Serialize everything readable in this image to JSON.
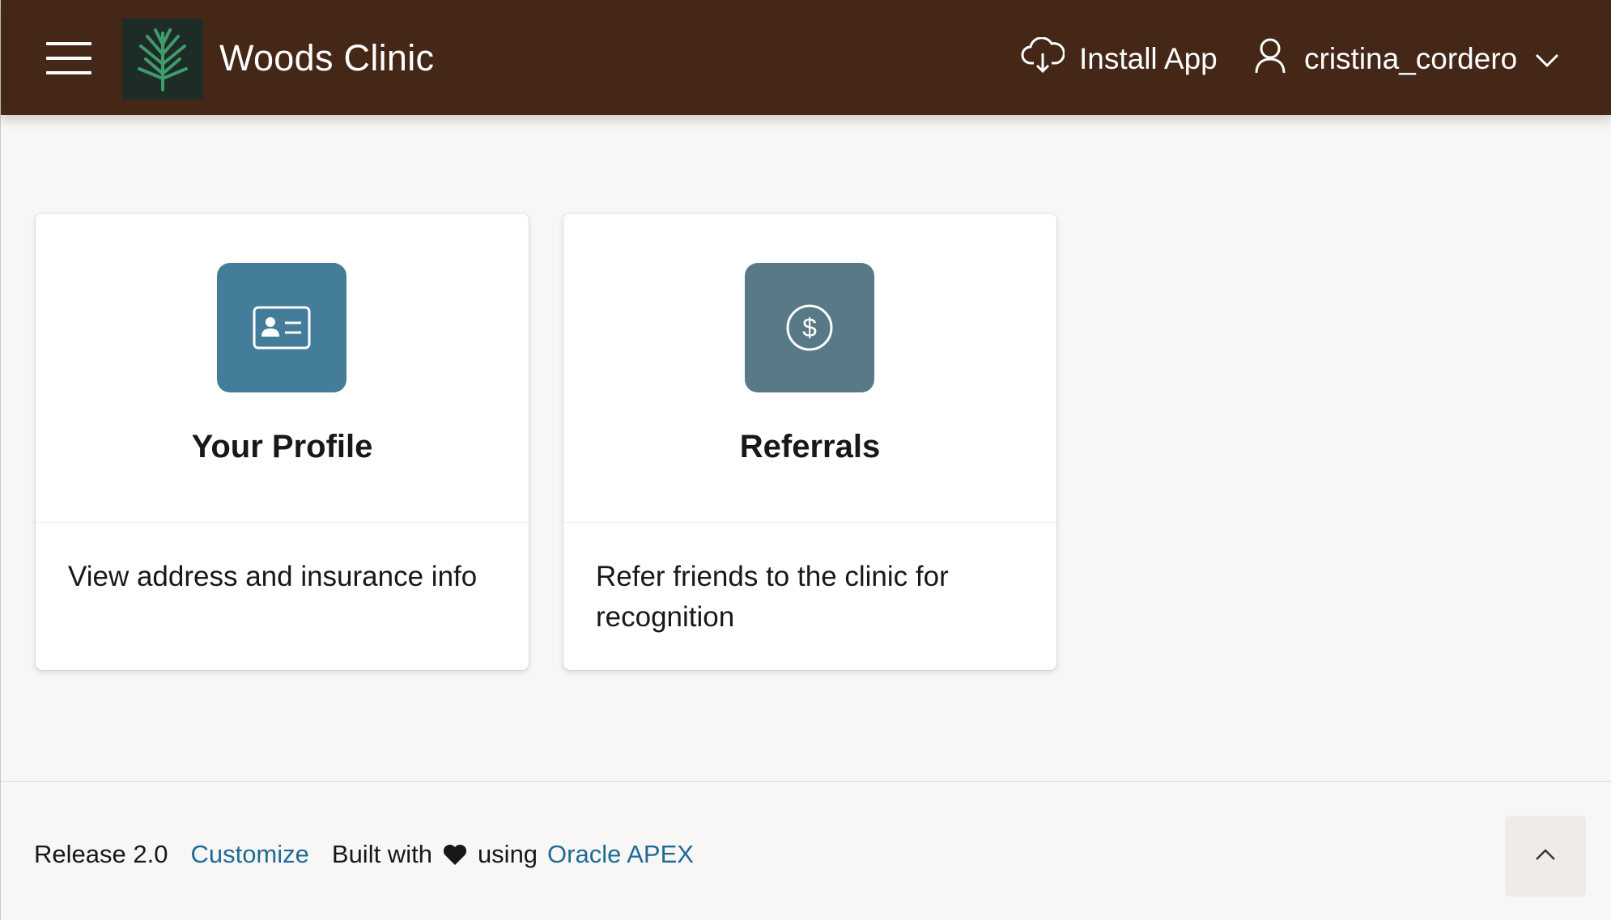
{
  "header": {
    "app_title": "Woods Clinic",
    "menu_icon": "hamburger-menu-icon",
    "logo_icon": "tree-logo-icon",
    "install_app_label": "Install App",
    "install_icon": "cloud-download-icon",
    "user_name": "cristina_cordero",
    "user_icon": "user-icon",
    "dropdown_icon": "chevron-down-icon"
  },
  "cards": [
    {
      "title": "Your Profile",
      "description": "View address and insurance info",
      "icon": "id-card-icon",
      "icon_color": "#437d99"
    },
    {
      "title": "Referrals",
      "description": "Refer friends to the clinic for recognition",
      "icon": "dollar-circle-icon",
      "icon_color": "#587a87"
    }
  ],
  "footer": {
    "release": "Release 2.0",
    "customize_link": "Customize",
    "built_with": "Built with",
    "heart_icon": "heart-icon",
    "using": "using",
    "apex_link": "Oracle APEX",
    "scroll_top_icon": "chevron-up-icon"
  },
  "colors": {
    "header_bg": "#452718",
    "link": "#1f6b96",
    "background": "#f8f7f5"
  }
}
